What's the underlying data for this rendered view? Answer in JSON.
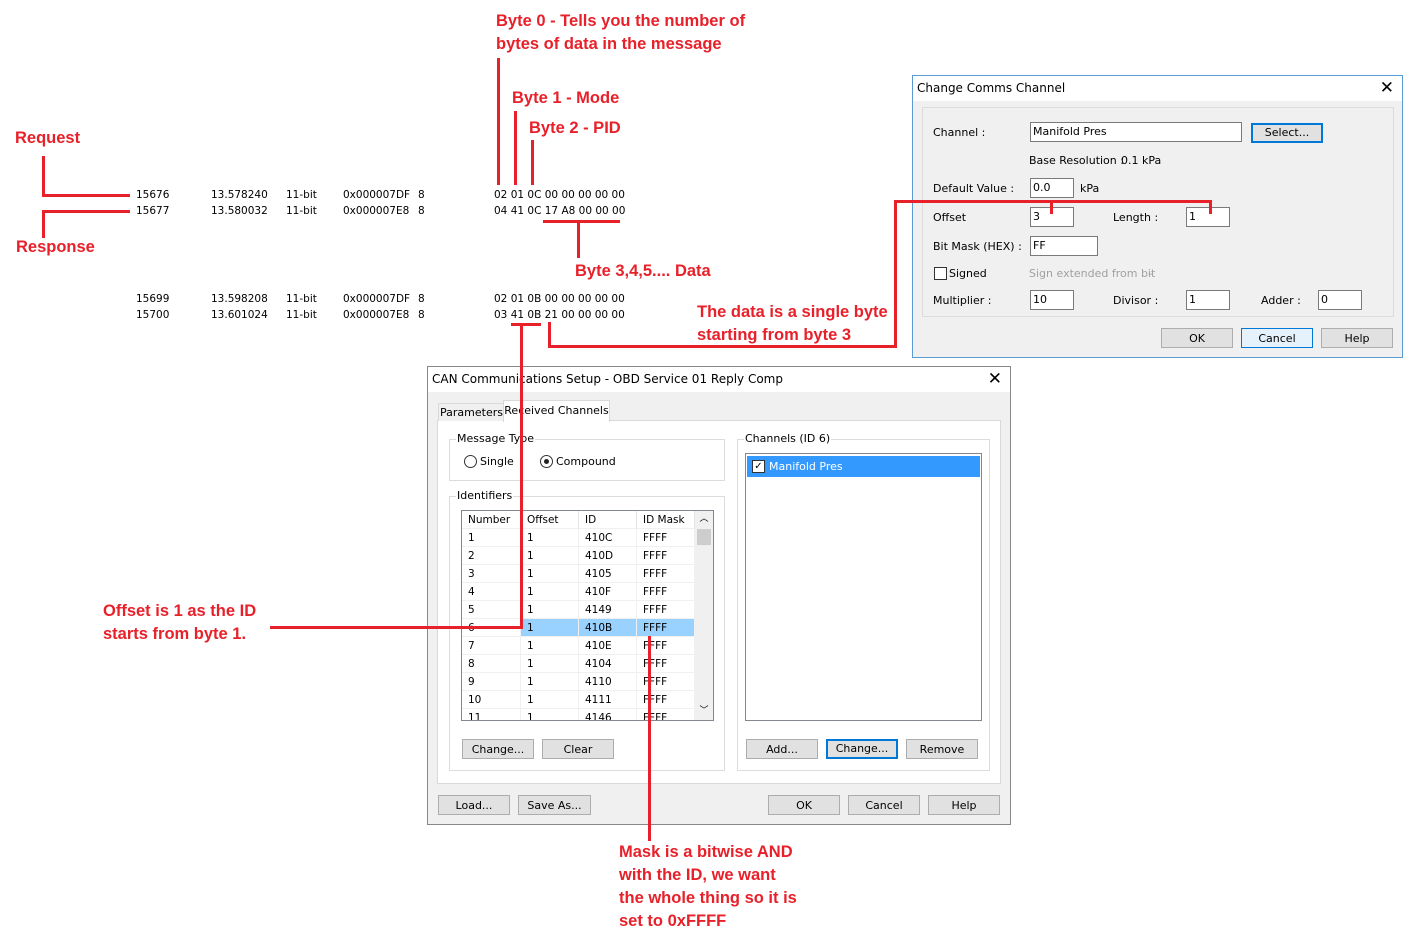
{
  "annotations": {
    "byte0": [
      "Byte 0 - Tells you the number of",
      "bytes of data in the message"
    ],
    "byte1": "Byte 1 - Mode",
    "byte2": "Byte 2 - PID",
    "request": "Request",
    "response": "Response",
    "data": "Byte 3,4,5.... Data",
    "single": [
      "The data is a single byte",
      "starting from byte 3"
    ],
    "offset": [
      "Offset is 1 as the ID",
      "starts from byte 1."
    ],
    "mask": [
      "Mask is a bitwise AND",
      "with the ID, we want",
      "the whole thing so it is",
      "set to 0xFFFF"
    ]
  },
  "log": [
    {
      "n": "15676",
      "t": "13.578240",
      "type": "11-bit",
      "id": "0x000007DF",
      "dlc": "8",
      "data": "02 01 0C 00 00 00 00 00"
    },
    {
      "n": "15677",
      "t": "13.580032",
      "type": "11-bit",
      "id": "0x000007E8",
      "dlc": "8",
      "data": "04 41 0C 17 A8 00 00 00"
    },
    {
      "n": "15699",
      "t": "13.598208",
      "type": "11-bit",
      "id": "0x000007DF",
      "dlc": "8",
      "data": "02 01 0B 00 00 00 00 00"
    },
    {
      "n": "15700",
      "t": "13.601024",
      "type": "11-bit",
      "id": "0x000007E8",
      "dlc": "8",
      "data": "03 41 0B 21 00 00 00 00"
    }
  ],
  "comms": {
    "title": "Change Comms Channel",
    "channel_label": "Channel :",
    "channel_value": "Manifold Pres",
    "select": "Select...",
    "base_res_label": "Base Resolution :",
    "base_res_value": "0.1 kPa",
    "default_label": "Default Value :",
    "default_value": "0.0",
    "unit": "kPa",
    "offset_label": "Offset",
    "offset_value": "3",
    "length_label": "Length :",
    "length_value": "1",
    "bitmask_label": "Bit Mask (HEX) :",
    "bitmask_value": "FF",
    "signed_label": "Signed",
    "signed_checked": false,
    "sign_ext": "Sign extended from bit",
    "sign_ext_value": "-",
    "mult_label": "Multiplier :",
    "mult_value": "10",
    "div_label": "Divisor :",
    "div_value": "1",
    "adder_label": "Adder :",
    "adder_value": "0",
    "ok": "OK",
    "cancel": "Cancel",
    "help": "Help"
  },
  "can": {
    "title": "CAN Communications Setup - OBD Service 01 Reply Comp",
    "tabs": [
      "Parameters",
      "Received Channels"
    ],
    "msg_type": "Message Type",
    "single": "Single",
    "compound": "Compound",
    "selected_type": "Compound",
    "identifiers": "Identifiers",
    "columns": [
      "Number",
      "Offset",
      "ID",
      "ID Mask"
    ],
    "rows": [
      [
        "1",
        "1",
        "410C",
        "FFFF"
      ],
      [
        "2",
        "1",
        "410D",
        "FFFF"
      ],
      [
        "3",
        "1",
        "4105",
        "FFFF"
      ],
      [
        "4",
        "1",
        "410F",
        "FFFF"
      ],
      [
        "5",
        "1",
        "4149",
        "FFFF"
      ],
      [
        "6",
        "1",
        "410B",
        "FFFF"
      ],
      [
        "7",
        "1",
        "410E",
        "FFFF"
      ],
      [
        "8",
        "1",
        "4104",
        "FFFF"
      ],
      [
        "9",
        "1",
        "4110",
        "FFFF"
      ],
      [
        "10",
        "1",
        "4111",
        "FFFF"
      ],
      [
        "11",
        "1",
        "4146",
        "FFFF"
      ]
    ],
    "selected_row": 5,
    "change": "Change...",
    "clear": "Clear",
    "channels": "Channels (ID 6)",
    "channel_items": [
      "Manifold Pres"
    ],
    "add": "Add...",
    "change2": "Change...",
    "remove": "Remove",
    "load": "Load...",
    "save_as": "Save As...",
    "ok": "OK",
    "cancel": "Cancel",
    "help": "Help"
  },
  "colors": {
    "annotation": "#e8202a",
    "selection": "#99d1ff",
    "accent": "#0078d7"
  }
}
